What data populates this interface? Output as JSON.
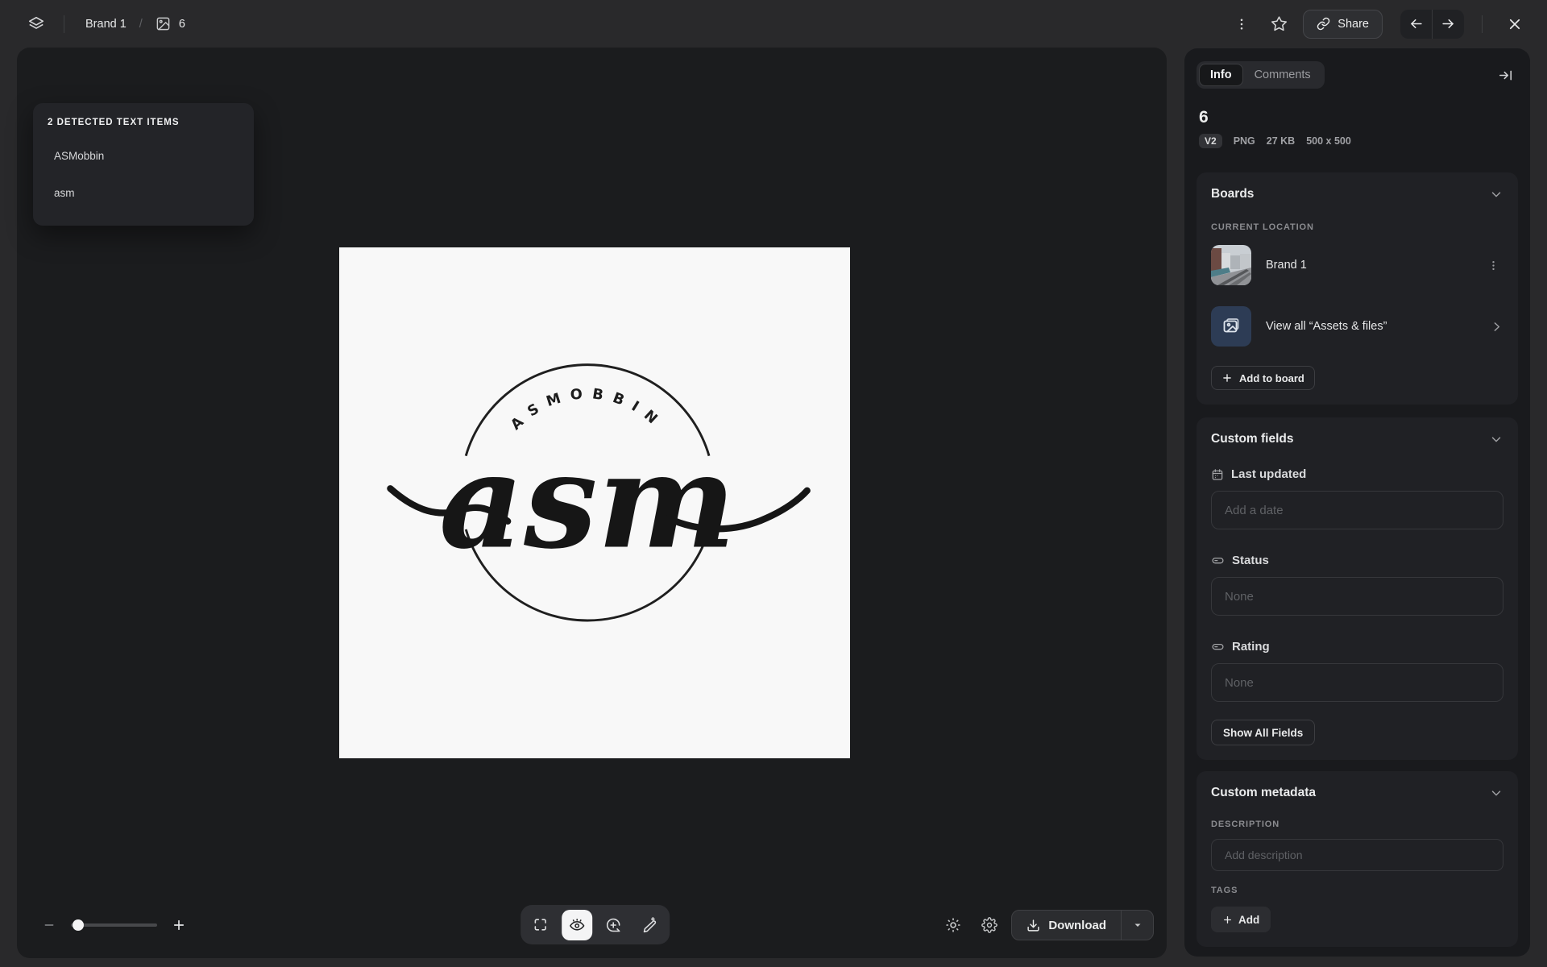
{
  "topbar": {
    "board": "Brand 1",
    "separator": "/",
    "asset": "6",
    "share_label": "Share"
  },
  "canvas": {
    "detected": {
      "title": "2 DETECTED TEXT ITEMS",
      "items": [
        "ASMobbin",
        "asm"
      ]
    }
  },
  "logo": {
    "arc_text": "ASMOBBIN",
    "script_text": "asm"
  },
  "viewer": {
    "download_label": "Download"
  },
  "sidebar": {
    "tabs": {
      "info": "Info",
      "comments": "Comments"
    },
    "title": "6",
    "meta": {
      "version": "V2",
      "format": "PNG",
      "size": "27 KB",
      "dimensions": "500 x 500"
    },
    "boards": {
      "header": "Boards",
      "current_location": "CURRENT LOCATION",
      "board_name": "Brand 1",
      "view_all": "View all “Assets & files”",
      "add_to_board": "Add to board"
    },
    "fields": {
      "header": "Custom fields",
      "items": [
        {
          "label": "Last updated",
          "placeholder": "Add a date"
        },
        {
          "label": "Status",
          "placeholder": "None"
        },
        {
          "label": "Rating",
          "placeholder": "None"
        }
      ],
      "show_all": "Show All Fields"
    },
    "metadata": {
      "header": "Custom metadata",
      "description_label": "DESCRIPTION",
      "description_placeholder": "Add description",
      "tags_label": "TAGS",
      "add_tag": "Add"
    }
  },
  "colors": {
    "page_bg": "#29292b",
    "canvas_bg": "#1b1c1e",
    "card_bg": "#202125",
    "accent_tile": "#2d3c55",
    "preview_bg": "#f8f8f8",
    "logo_ink": "#1a1a1a",
    "active_tool_bg": "#f4f4f5"
  }
}
